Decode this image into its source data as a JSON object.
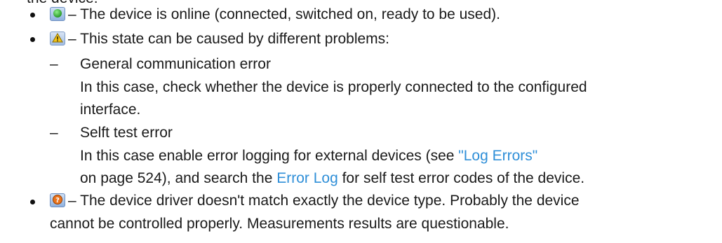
{
  "top_partial": "the device:",
  "items": {
    "online": {
      "icon": "online-status-icon",
      "text": "– The device is online (connected, switched on, ready to be used)."
    },
    "warning": {
      "icon": "warning-status-icon",
      "text": "– This state can be caused by different problems:",
      "sub1": {
        "dash": "–",
        "title": "General communication error",
        "line1": "In this case, check whether the device is properly connected to the configured",
        "line2": "interface."
      },
      "sub2": {
        "dash": "–",
        "title": "Selft test error",
        "line1_pre": "In this case enable error logging for external devices (see ",
        "line1_link": "\"Log Errors\"",
        "line2_pre": "on page 524), and search the ",
        "line2_link": "Error Log",
        "line2_post": " for self test error codes of the device."
      }
    },
    "mismatch": {
      "icon": "driver-mismatch-icon",
      "line1": "– The device driver doesn't match exactly the device type. Probably the device",
      "line2": "cannot be controlled properly. Measurements results are questionable."
    }
  },
  "colors": {
    "text": "#1a1a1a",
    "link": "#2f8fd8"
  }
}
